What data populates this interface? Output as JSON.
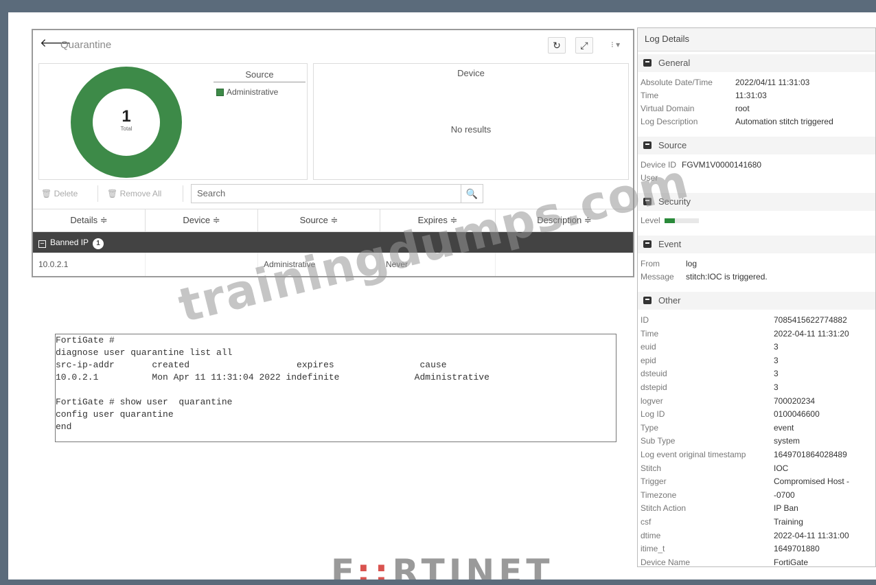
{
  "quarantine": {
    "title": "Quarantine",
    "header_icons": [
      "back-arrow-icon",
      "refresh-icon",
      "external-link-icon",
      "more-menu-icon"
    ],
    "header_glyphs": {
      "back": "🡐",
      "refresh": "↻",
      "external": "⤢",
      "menu": "⁝ ▾"
    },
    "donut": {
      "count": "1",
      "label": "Total",
      "segments": [
        {
          "name": "Administrative",
          "value": 1,
          "color": "#3d8a48"
        }
      ]
    },
    "source": {
      "title": "Source",
      "legend_items": [
        "Administrative"
      ]
    },
    "device": {
      "title": "Device",
      "empty_text": "No results"
    },
    "toolbar": {
      "delete_label": "Delete",
      "remove_all_label": "Remove All",
      "search_placeholder": "Search",
      "search_icon": "🔍"
    },
    "table": {
      "columns": [
        "Details ≑",
        "Device ≑",
        "Source ≑",
        "Expires ≑",
        "Description ≑"
      ],
      "group": {
        "label": "Banned IP",
        "count": "1"
      },
      "rows": [
        {
          "details": "10.0.2.1",
          "device": "",
          "source": "Administrative",
          "expires": "Never",
          "description": ""
        }
      ]
    }
  },
  "cli": {
    "lines": [
      "FortiGate #",
      "diagnose user quarantine list all",
      "src-ip-addr       created                    expires                cause",
      "10.0.2.1          Mon Apr 11 11:31:04 2022 indefinite              Administrative",
      "",
      "FortiGate # show user  quarantine",
      "config user quarantine",
      "end"
    ]
  },
  "log_details": {
    "title": "Log Details",
    "general": {
      "title": "General",
      "absolute_date_time_key": "Absolute Date/Time",
      "absolute_date_time": "2022/04/11 11:31:03",
      "time_key": "Time",
      "time": "11:31:03",
      "virtual_domain_key": "Virtual Domain",
      "virtual_domain": "root",
      "log_description_key": "Log Description",
      "log_description": "Automation stitch triggered"
    },
    "source": {
      "title": "Source",
      "device_id_key": "Device ID",
      "device_id": "FGVM1V0000141680",
      "user_key": "User"
    },
    "security": {
      "title": "Security",
      "level_key": "Level",
      "level_fraction": 0.3
    },
    "event": {
      "title": "Event",
      "from_key": "From",
      "from": "log",
      "message_key": "Message",
      "message": "stitch:IOC is triggered."
    },
    "other": {
      "title": "Other",
      "rows": [
        {
          "k": "ID",
          "v": "7085415622774882"
        },
        {
          "k": "Time",
          "v": "2022-04-11 11:31:20"
        },
        {
          "k": "euid",
          "v": "3"
        },
        {
          "k": "epid",
          "v": "3"
        },
        {
          "k": "dsteuid",
          "v": "3"
        },
        {
          "k": "dstepid",
          "v": "3"
        },
        {
          "k": "logver",
          "v": "700020234"
        },
        {
          "k": "Log ID",
          "v": "0100046600"
        },
        {
          "k": "Type",
          "v": "event"
        },
        {
          "k": "Sub Type",
          "v": "system"
        },
        {
          "k": "Log event original timestamp",
          "v": "1649701864028489"
        },
        {
          "k": "Stitch",
          "v": "IOC"
        },
        {
          "k": "Trigger",
          "v": "Compromised Host -"
        },
        {
          "k": "Timezone",
          "v": "-0700"
        },
        {
          "k": "Stitch Action",
          "v": "IP Ban"
        },
        {
          "k": "csf",
          "v": "Training"
        },
        {
          "k": "dtime",
          "v": "2022-04-11 11:31:00"
        },
        {
          "k": "itime_t",
          "v": "1649701880"
        },
        {
          "k": "Device Name",
          "v": "FortiGate"
        }
      ]
    }
  },
  "watermark": "trainingdumps.com",
  "brand": {
    "left": "F",
    "mid": "::",
    "right": "RTINET"
  }
}
